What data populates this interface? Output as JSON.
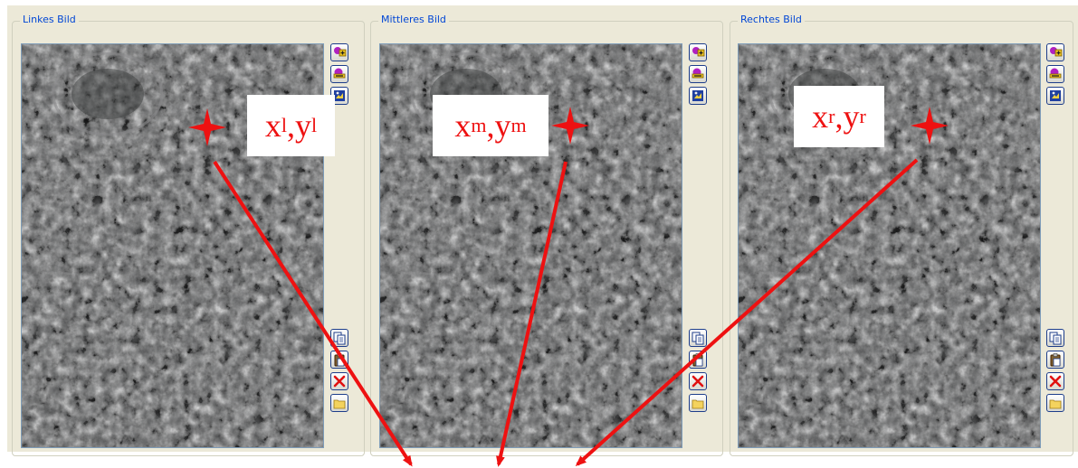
{
  "panels": [
    {
      "title": "Linkes Bild",
      "label": {
        "x": "x",
        "sx": "l",
        "sep": ",",
        "y": "y",
        "sy": "l"
      }
    },
    {
      "title": "Mittleres Bild",
      "label": {
        "x": "x",
        "sx": "m",
        "sep": ",",
        "y": "y",
        "sy": "m"
      }
    },
    {
      "title": "Rechtes Bild",
      "label": {
        "x": "x",
        "sx": "r",
        "sep": ",",
        "y": "y",
        "sy": "r"
      }
    }
  ],
  "toolbar_icons": [
    "zoom-in-icon",
    "zoom-out-icon",
    "fit-image-icon",
    "copy-icon",
    "paste-icon",
    "delete-icon",
    "open-folder-icon"
  ],
  "colors": {
    "annotation": "#ee1111",
    "group_title": "#0046d5",
    "window_bg": "#ece9d8",
    "image_bg": "#58595a"
  }
}
